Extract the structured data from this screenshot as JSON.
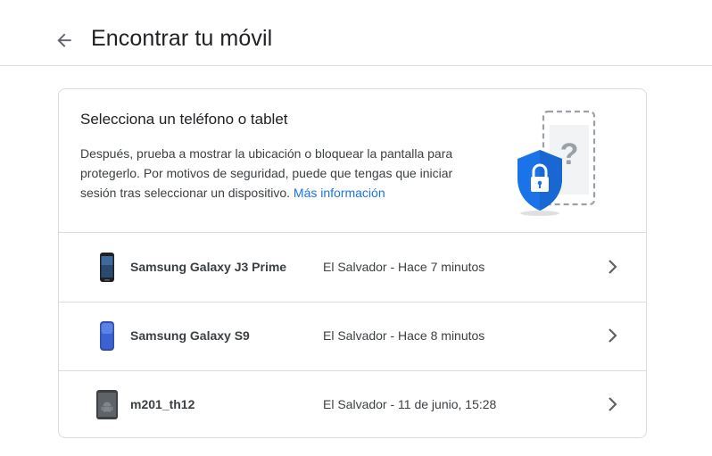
{
  "header": {
    "title": "Encontrar tu móvil",
    "back_icon": "arrow-back-icon"
  },
  "intro": {
    "title": "Selecciona un teléfono o tablet",
    "description": "Después, prueba a mostrar la ubicación o bloquear la pantalla para protegerlo. Por motivos de seguridad, puede que tengas que iniciar sesión tras seleccionar un dispositivo.",
    "link": "Más información",
    "illustration_icon": "phone-lock-question-icon"
  },
  "devices": [
    {
      "name": "Samsung Galaxy J3 Prime",
      "location": "El Salvador - Hace 7 minutos",
      "icon": "phone-dark-icon"
    },
    {
      "name": "Samsung Galaxy S9",
      "location": "El Salvador - Hace 8 minutos",
      "icon": "phone-blue-icon"
    },
    {
      "name": "m201_th12",
      "location": "El Salvador - 11 de junio, 15:28",
      "icon": "android-tablet-icon"
    }
  ],
  "colors": {
    "link": "#1a73e8",
    "shield": "#1a73e8",
    "border": "#dadce0"
  }
}
